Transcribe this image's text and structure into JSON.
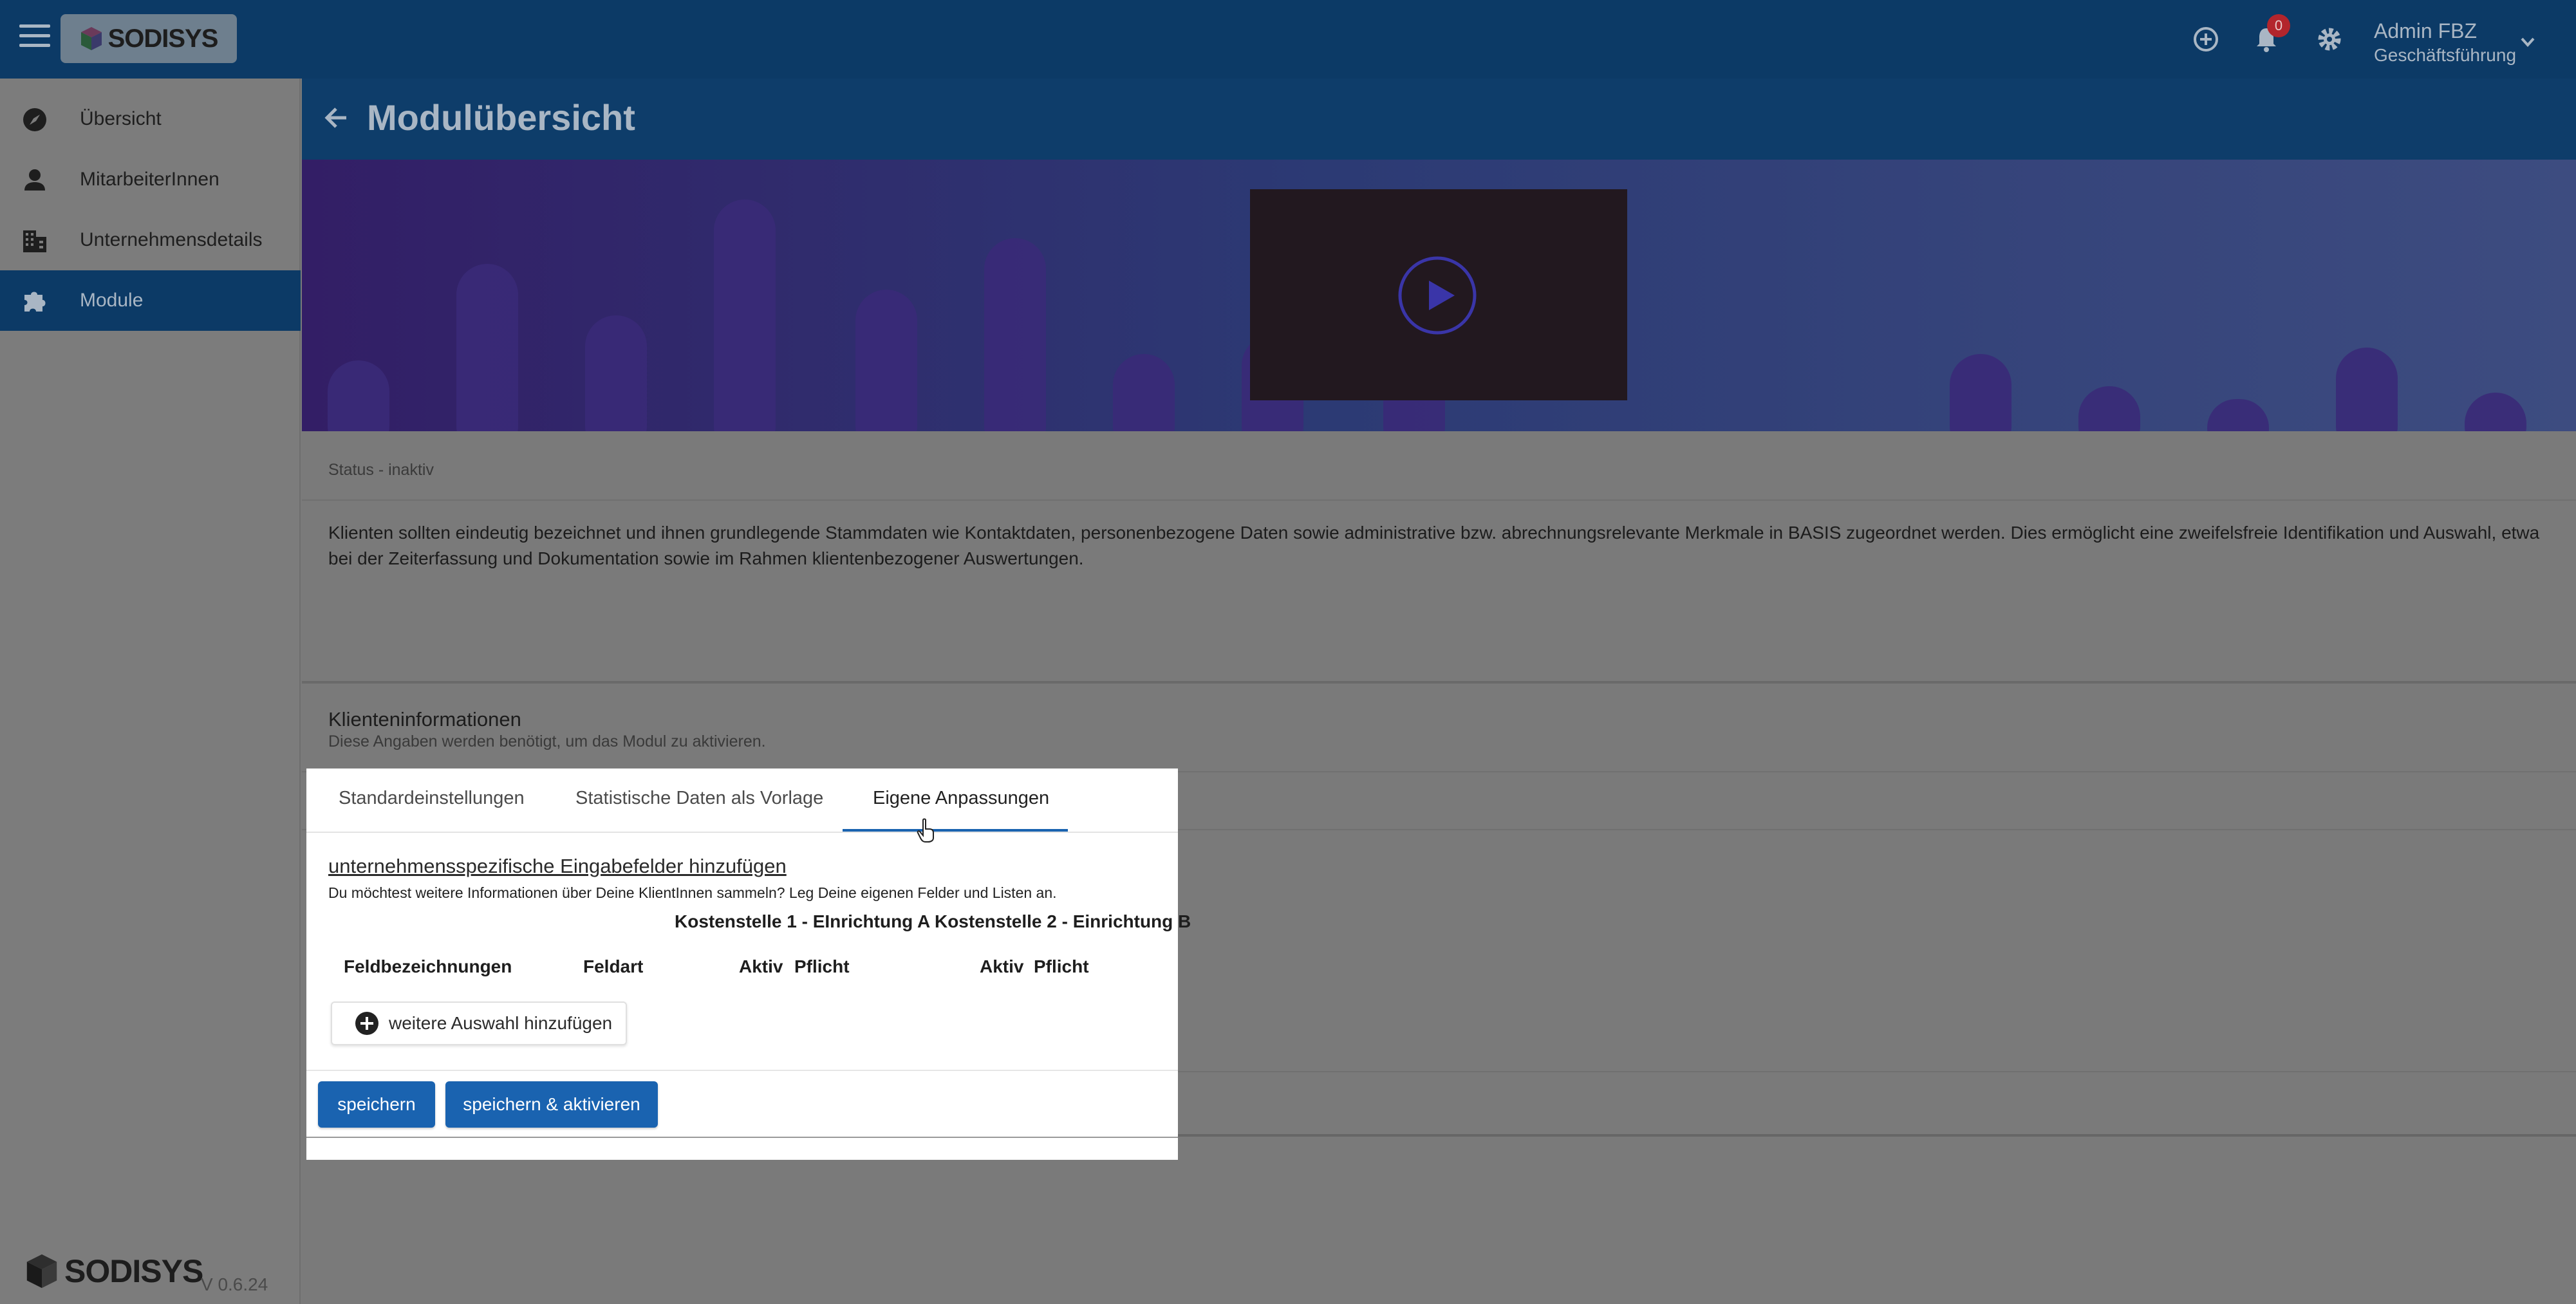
{
  "topbar": {
    "logo_text": "SODISYS",
    "notifications_count": "0",
    "user_name": "Admin FBZ",
    "user_role": "Geschäftsführung"
  },
  "sidebar": {
    "items": [
      {
        "label": "Übersicht",
        "icon": "compass-icon"
      },
      {
        "label": "MitarbeiterInnen",
        "icon": "person-icon"
      },
      {
        "label": "Unternehmensdetails",
        "icon": "building-icon"
      },
      {
        "label": "Module",
        "icon": "puzzle-icon",
        "active": true
      }
    ],
    "footer_logo": "SODISYS",
    "version": "V 0.6.24"
  },
  "page": {
    "title": "Modulübersicht"
  },
  "module": {
    "status": "Status - inaktiv",
    "description": "Klienten sollten eindeutig bezeichnet und ihnen grundlegende Stammdaten wie Kontaktdaten, personenbezogene Daten sowie administrative bzw. abrechnungsrelevante Merkmale in BASIS zugeordnet werden. Dies ermöglicht eine zweifelsfreie Identifikation und Auswahl, etwa bei der Zeiterfassung und Dokumentation sowie im Rahmen klientenbezogener Auswertungen.",
    "section_title": "Klienteninformationen",
    "section_subtitle": "Diese Angaben werden benötigt, um das Modul zu aktivieren."
  },
  "panel": {
    "tabs": [
      {
        "label": "Standardeinstellungen"
      },
      {
        "label": "Statistische Daten als Vorlage"
      },
      {
        "label": "Eigene Anpassungen",
        "active": true
      }
    ],
    "custom_link": "unternehmensspezifische Eingabefelder hinzufügen",
    "custom_hint": "Du möchtest weitere Informationen über Deine KlientInnen sammeln? Leg Deine eigenen Felder und Listen an.",
    "cost_centers": "Kostenstelle 1 - EInrichtung A Kostenstelle 2 - Einrichtung B",
    "columns": {
      "field_names": "Feldbezeichnungen",
      "field_type": "Feldart",
      "active_1": "Aktiv",
      "required_1": "Pflicht",
      "active_2": "Aktiv",
      "required_2": "Pflicht"
    },
    "add_choice_label": "weitere Auswahl hinzufügen",
    "save_label": "speichern",
    "save_activate_label": "speichern & aktivieren"
  },
  "colors": {
    "header": "#0c3a66",
    "accent": "#1a63b0",
    "badge": "#b3252c"
  }
}
